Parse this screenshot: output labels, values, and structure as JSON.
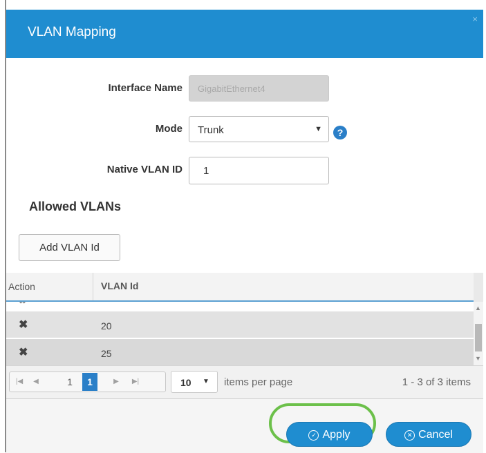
{
  "dialog": {
    "title": "VLAN Mapping",
    "close_glyph": "×"
  },
  "form": {
    "interface_name_label": "Interface Name",
    "interface_name_value": "GigabitEthernet4",
    "mode_label": "Mode",
    "mode_value": "Trunk",
    "mode_caret": "▼",
    "help_glyph": "?",
    "native_vlan_label": "Native VLAN ID",
    "native_vlan_value": "1"
  },
  "allowed": {
    "title": "Allowed VLANs",
    "add_button": "Add VLAN Id"
  },
  "grid": {
    "columns": [
      "Action",
      "VLAN Id"
    ],
    "rows": [
      {
        "action": "✖",
        "vlan": "20"
      },
      {
        "action": "✖",
        "vlan": "25"
      }
    ],
    "scroll_up": "▲",
    "scroll_down": "▼"
  },
  "pager": {
    "first": "|◀",
    "prev": "◀",
    "page_plain": "1",
    "page_active": "1",
    "next": "▶",
    "last": "▶|",
    "per_page_value": "10",
    "per_page_caret": "▼",
    "per_page_label": "items per page",
    "items_info": "1 - 3 of 3 items"
  },
  "footer": {
    "apply_label": "Apply",
    "apply_icon": "check-circle-icon",
    "apply_glyph": "✓",
    "cancel_label": "Cancel",
    "cancel_icon": "x-circle-icon",
    "cancel_glyph": "✕"
  },
  "colors": {
    "header": "#1f8dd0",
    "primary_button": "#1f8dd0",
    "highlight_ring": "#6cc04a",
    "active_page": "#2a7fc8"
  }
}
